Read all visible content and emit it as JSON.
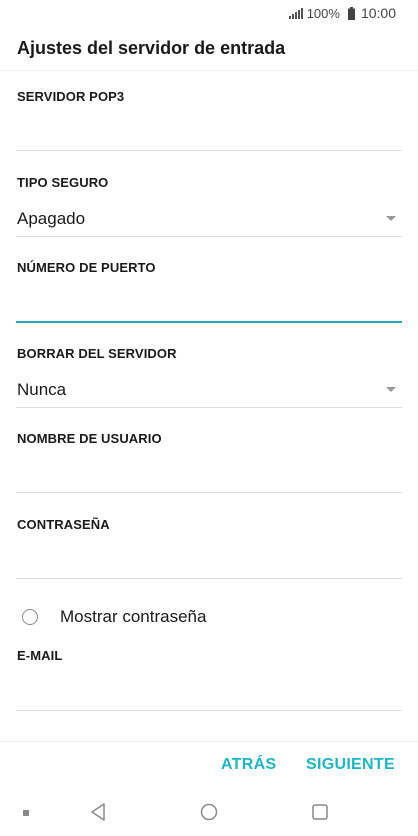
{
  "status_bar": {
    "battery_percent": "100%",
    "time": "10:00"
  },
  "header": {
    "title": "Ajustes del servidor de entrada"
  },
  "form": {
    "pop3_server": {
      "label": "SERVIDOR POP3",
      "value": ""
    },
    "security_type": {
      "label": "TIPO SEGURO",
      "value": "Apagado"
    },
    "port_number": {
      "label": "NÚMERO DE PUERTO",
      "value": ""
    },
    "delete_from_server": {
      "label": "BORRAR DEL SERVIDOR",
      "value": "Nunca"
    },
    "username": {
      "label": "NOMBRE DE USUARIO",
      "value": ""
    },
    "password": {
      "label": "CONTRASEÑA",
      "value": ""
    },
    "show_password": {
      "label": "Mostrar contraseña",
      "checked": false
    },
    "email": {
      "label": "E-MAIL",
      "value": ""
    }
  },
  "actions": {
    "back_label": "ATRÁS",
    "next_label": "SIGUIENTE"
  },
  "colors": {
    "accent": "#1fb5c4",
    "focus_line": "#26a8b8"
  },
  "nav_icons": [
    "back-triangle-icon",
    "home-circle-icon",
    "recents-square-icon"
  ]
}
